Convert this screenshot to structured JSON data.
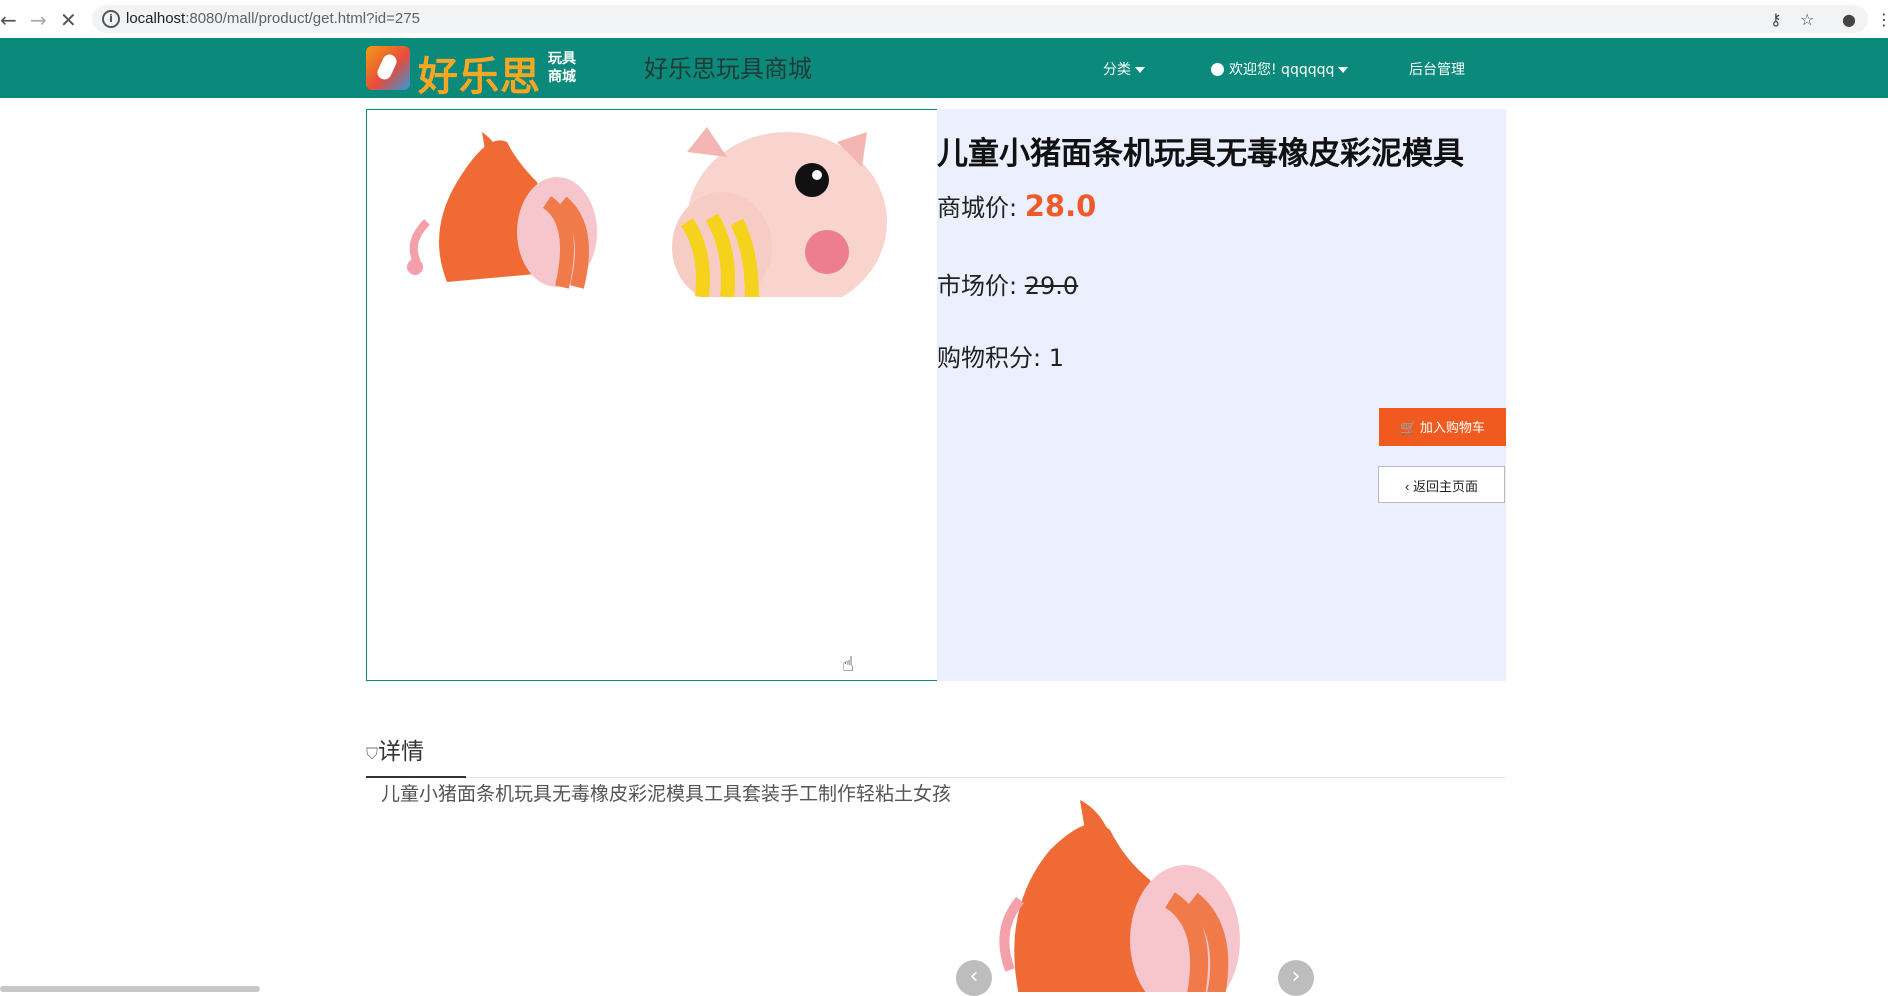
{
  "browser": {
    "url_host": "localhost",
    "url_rest": ":8080/mall/product/get.html?id=275"
  },
  "header": {
    "logo_main": "好乐思",
    "logo_sub": "玩具商城",
    "site_title": "好乐思玩具商城",
    "menu_category": "分类",
    "menu_user": "欢迎您! qqqqqq",
    "menu_admin": "后台管理"
  },
  "product": {
    "title": "儿童小猪面条机玩具无毒橡皮彩泥模具",
    "mall_price_label": "商城价:",
    "mall_price": "28.0",
    "market_price_label": "市场价:",
    "market_price": "29.0",
    "points_label": "购物积分:",
    "points": "1",
    "add_cart_label": "加入购物车",
    "back_label": "返回主页面"
  },
  "details": {
    "tab_label": "详情",
    "description": "儿童小猪面条机玩具无毒橡皮彩泥模具工具套装手工制作轻粘土女孩"
  },
  "colors": {
    "header_bg": "#0b8a7b",
    "accent_price": "#f05a28",
    "info_panel_bg": "#eceffd"
  }
}
